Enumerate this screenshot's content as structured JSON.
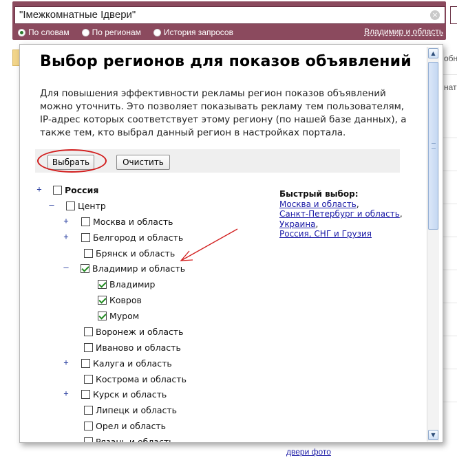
{
  "search": {
    "query": "\"Iмежкомнатные Iдвери\"",
    "clear_icon": "×",
    "modes": [
      "По словам",
      "По регионам",
      "История запросов"
    ],
    "selected_mode_index": 0,
    "region_link": "Владимир и область"
  },
  "background": {
    "right_texts": [
      "обно",
      "нат"
    ],
    "bottom_link": "двери фото"
  },
  "dialog": {
    "title": "Выбор регионов для показов объявлений",
    "description": "Для повышения эффективности рекламы регион показов объявлений можно уточнить. Это позволяет показывать рекламу тем пользователям, IP-адрес которых соответствует этому региону (по нашей базе данных), а также тем, кто выбрал данный регион в настройках портала.",
    "buttons": {
      "choose": "Выбрать",
      "clear": "Очистить"
    },
    "tree": [
      {
        "label": "Россия",
        "toggle": "+",
        "checked": false,
        "bold": true
      },
      {
        "label": "Центр",
        "toggle": "–",
        "checked": false
      },
      {
        "label": "Москва и область",
        "toggle": "+",
        "checked": false
      },
      {
        "label": "Белгород и область",
        "toggle": "+",
        "checked": false
      },
      {
        "label": "Брянск и область",
        "toggle": "",
        "checked": false
      },
      {
        "label": "Владимир и область",
        "toggle": "–",
        "checked": true
      },
      {
        "label": "Владимир",
        "toggle": "",
        "checked": true
      },
      {
        "label": "Ковров",
        "toggle": "",
        "checked": true
      },
      {
        "label": "Муром",
        "toggle": "",
        "checked": true
      },
      {
        "label": "Воронеж и область",
        "toggle": "",
        "checked": false
      },
      {
        "label": "Иваново и область",
        "toggle": "",
        "checked": false
      },
      {
        "label": "Калуга и область",
        "toggle": "+",
        "checked": false
      },
      {
        "label": "Кострома и область",
        "toggle": "",
        "checked": false
      },
      {
        "label": "Курск и область",
        "toggle": "+",
        "checked": false
      },
      {
        "label": "Липецк и область",
        "toggle": "",
        "checked": false
      },
      {
        "label": "Орел и область",
        "toggle": "",
        "checked": false
      },
      {
        "label": "Рязань и область",
        "toggle": "",
        "checked": false
      }
    ],
    "quick_select": {
      "title": "Быстрый выбор:",
      "links": [
        "Москва и область",
        "Санкт-Петербург и область",
        "Украина",
        "Россия, СНГ и Грузия"
      ]
    },
    "scroll_up_icon": "▲",
    "scroll_down_icon": "▼"
  },
  "colors": {
    "header": "#8b4a5e",
    "link": "#1a1aa6",
    "highlight": "#d21e1e",
    "check": "#1f8a1f"
  }
}
